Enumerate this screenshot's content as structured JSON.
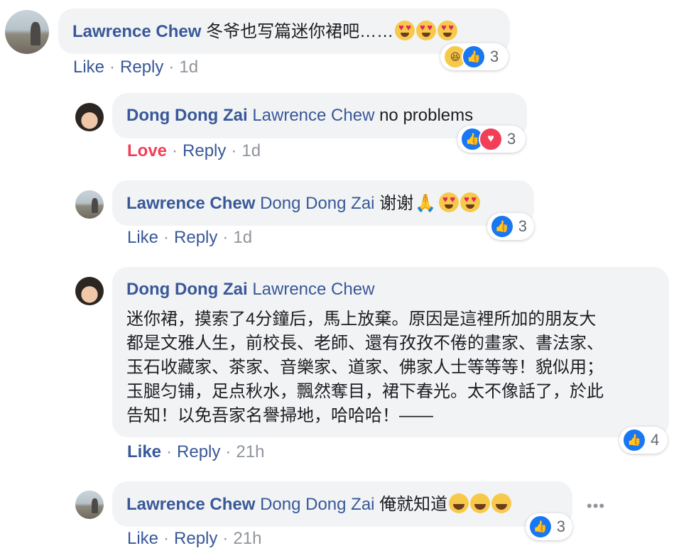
{
  "comments": [
    {
      "author": "Lawrence Chew",
      "tag": "",
      "text": "冬爷也写篇迷你裙吧……",
      "actions": {
        "reaction": "Like",
        "reply": "Reply",
        "time": "1d"
      },
      "reactions": {
        "icons": [
          "haha-icon",
          "like-icon"
        ],
        "count": "3"
      }
    },
    {
      "author": "Dong Dong Zai",
      "tag": "Lawrence Chew",
      "text": "no problems",
      "actions": {
        "reaction": "Love",
        "reply": "Reply",
        "time": "1d"
      },
      "reactions": {
        "icons": [
          "like-icon",
          "love-icon"
        ],
        "count": "3"
      }
    },
    {
      "author": "Lawrence Chew",
      "tag": "Dong Dong Zai",
      "text": "谢谢",
      "actions": {
        "reaction": "Like",
        "reply": "Reply",
        "time": "1d"
      },
      "reactions": {
        "icons": [
          "like-icon"
        ],
        "count": "3"
      }
    },
    {
      "author": "Dong Dong Zai",
      "tag": "Lawrence Chew",
      "text": "迷你裙，摸索了4分鐘后，馬上放棄。原因是這裡所加的朋友大\n都是文雅人生，前校長、老師、還有孜孜不倦的畫家、書法家、\n玉石收藏家、茶家、音樂家、道家、佛家人士等等等！貌似用；\n玉腿匀铺，足点秋水，飄然奪目，裙下春光。太不像話了，於此\n告知！以免吾家名譽掃地，哈哈哈！——",
      "actions": {
        "reaction": "Like",
        "reply": "Reply",
        "time": "21h"
      },
      "reactions": {
        "icons": [
          "like-icon"
        ],
        "count": "4"
      }
    },
    {
      "author": "Lawrence Chew",
      "tag": "Dong Dong Zai",
      "text": "俺就知道",
      "actions": {
        "reaction": "Like",
        "reply": "Reply",
        "time": "21h"
      },
      "reactions": {
        "icons": [
          "like-icon"
        ],
        "count": "3"
      }
    }
  ],
  "colors": {
    "name": "#385898",
    "love": "#f33e58",
    "bubble": "#f2f3f5",
    "meta": "#90949c"
  },
  "separator": "·",
  "more_icon": "more-horizontal-icon"
}
